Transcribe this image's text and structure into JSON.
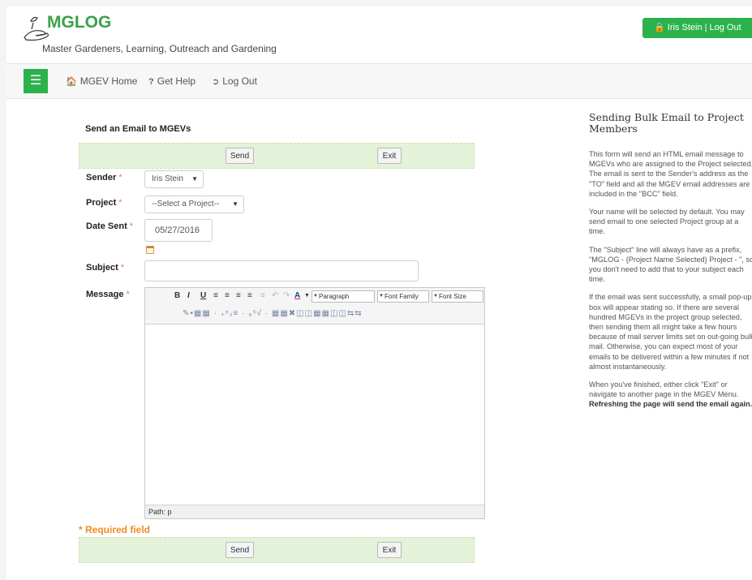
{
  "header": {
    "app_title": "MGLOG",
    "tagline": "Master Gardeners, Learning, Outreach and Gardening",
    "user_button": "Iris Stein | Log Out"
  },
  "nav": {
    "items": [
      {
        "label": "MGEV Home",
        "icon": "home-icon"
      },
      {
        "label": "Get Help",
        "icon": "question-icon"
      },
      {
        "label": "Log Out",
        "icon": "logout-icon"
      }
    ]
  },
  "form": {
    "title": "Send an Email to MGEVs",
    "send_label": "Send",
    "exit_label": "Exit",
    "sender_label": "Sender",
    "sender_value": "Iris Stein",
    "project_label": "Project",
    "project_value": "--Select a Project--",
    "date_label": "Date Sent",
    "date_value": "05/27/2016",
    "subject_label": "Subject",
    "subject_value": "",
    "message_label": "Message",
    "required_marker": "*",
    "required_note": "* Required field"
  },
  "editor": {
    "bold": "B",
    "italic": "I",
    "underline": "U",
    "format_select": "Paragraph",
    "font_family_select": "Font Family",
    "font_size_select": "Font Size",
    "path_text": "Path: p"
  },
  "sidebar": {
    "title": "Sending Bulk Email to Project Members",
    "p1": "This form will send an HTML email message to MGEVs who are assigned to the Project selected. The email is sent to the Sender's address as the \"TO\" field and all the MGEV email addresses are included in the \"BCC\" field.",
    "p2": "Your name will be selected by default. You may send email to one selected Project group at a time.",
    "p3": "The \"Subject\" line will always have as a prefix, \"MGLOG - {Project Name Selected} Project - \", so you don't need to add that to your subject each time.",
    "p4": "If the email was sent successfully, a small pop-up box will appear stating so. If there are several hundred MGEVs in the project group selected, then sending them all might take a few hours because of mail server limits set on out-going bulk mail. Otherwise, you can expect most of your emails to be delivered within a few minutes if not almost instantaneously.",
    "p5_start": "When you've finished, either click \"Exit\" or navigate to another page in the MGEV Menu.",
    "p5_bold": "Refreshing the page will send the email again."
  },
  "colors": {
    "brand_green": "#2bb24c",
    "button_bar": "#e4f2d9",
    "required_orange": "#f08a24",
    "required_star": "#f27474"
  }
}
